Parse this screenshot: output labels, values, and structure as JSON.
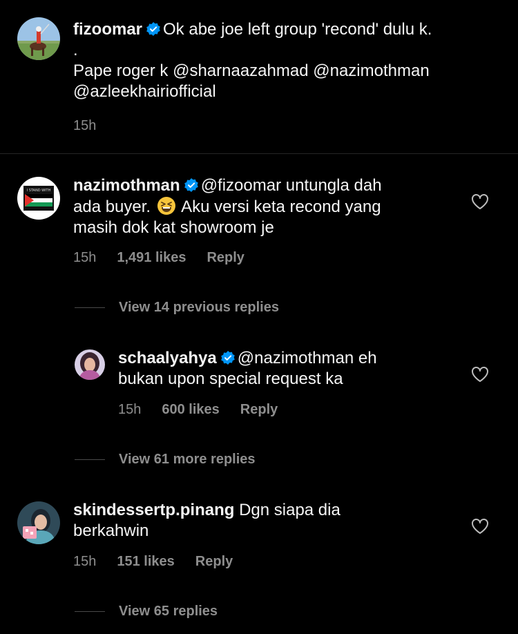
{
  "comments": [
    {
      "username": "fizoomar",
      "line1": "Ok abe joe left group 'recond' dulu k.",
      "line2": ".",
      "line3": "Pape roger k @sharnaazahmad @nazimothman",
      "line4": "@azleekhairiofficial",
      "time": "15h"
    },
    {
      "username": "nazimothman",
      "line1": "@fizoomar untungla dah",
      "line2a": "ada buyer.",
      "line2b": "Aku versi keta recond yang",
      "line3": "masih dok kat showroom je",
      "time": "15h",
      "likes": "1,491 likes",
      "reply": "Reply",
      "view_replies": "View 14 previous replies"
    },
    {
      "username": "schaalyahya",
      "line1": "@nazimothman eh",
      "line2": "bukan upon special request ka",
      "time": "15h",
      "likes": "600 likes",
      "reply": "Reply",
      "view_replies": "View 61 more replies"
    },
    {
      "username": "skindessertp.pinang",
      "line1": "Dgn siapa dia",
      "line2": "berkahwin",
      "time": "15h",
      "likes": "151 likes",
      "reply": "Reply",
      "view_replies": "View 65 replies"
    }
  ],
  "avatar_text": {
    "stand_with": "I STAND WITH"
  },
  "icons": {
    "verified": "verified-badge-icon",
    "heart": "heart-outline-icon",
    "emoji": "grinning-squinting-face-emoji"
  },
  "colors": {
    "background": "#000000",
    "text": "#f5f5f5",
    "muted": "#8e8e8e",
    "verified": "#0095f6"
  }
}
